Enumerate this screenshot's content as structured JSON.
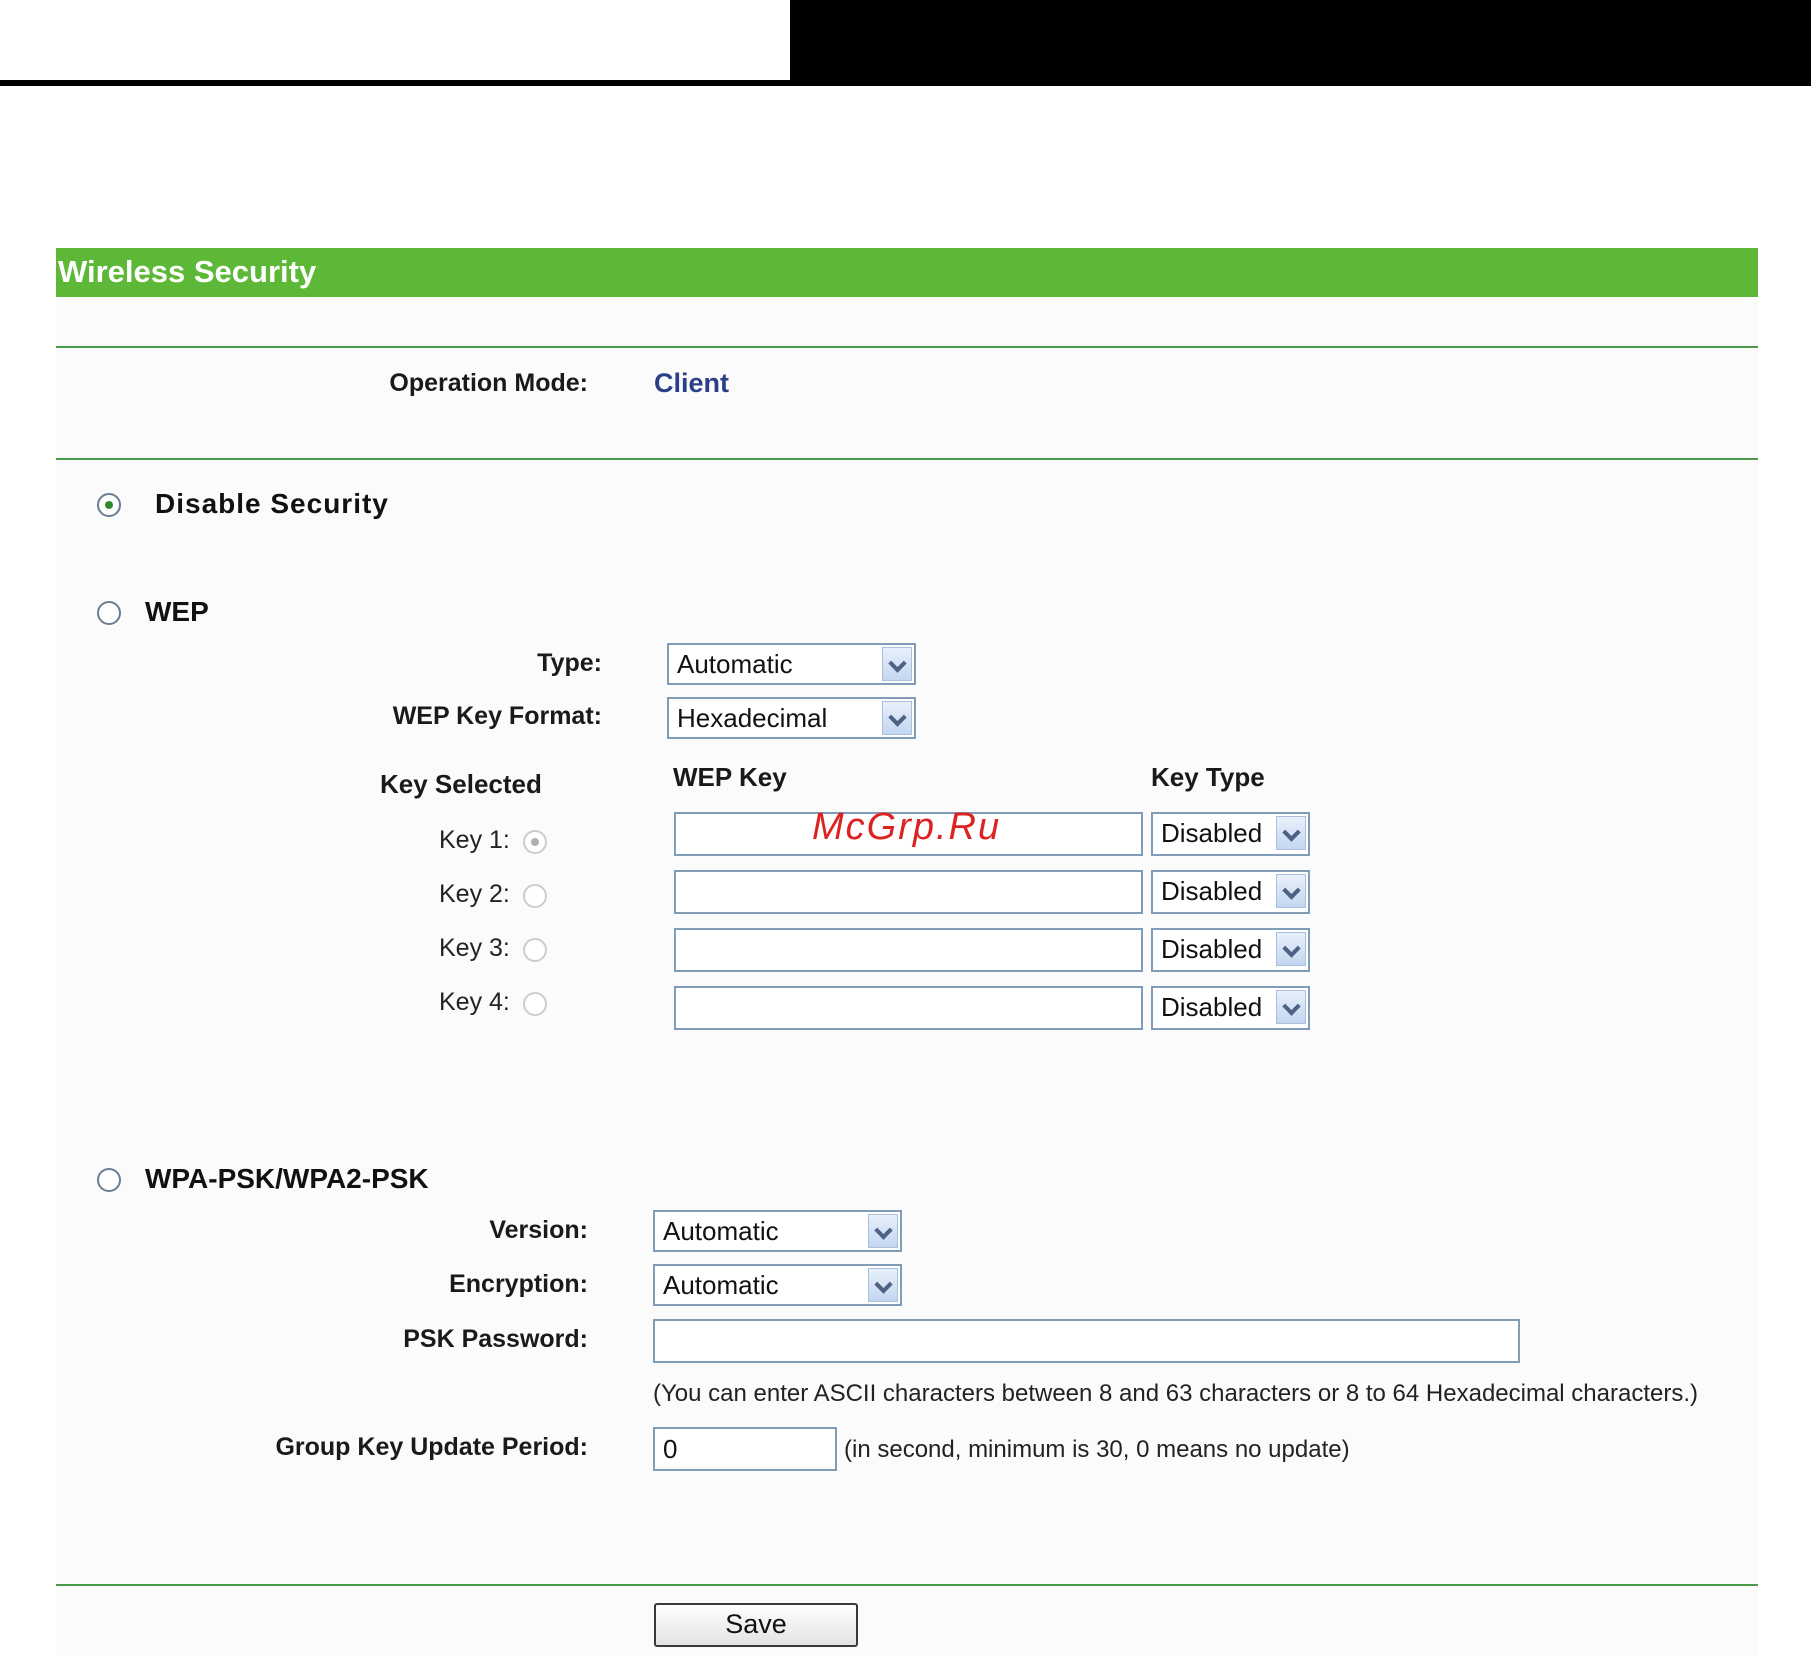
{
  "header": {
    "title": "Wireless Security"
  },
  "operation_mode": {
    "label": "Operation Mode:",
    "value": "Client"
  },
  "disable_security": {
    "label": "Disable Security",
    "selected": true
  },
  "wep": {
    "label": "WEP",
    "type_label": "Type:",
    "type_value": "Automatic",
    "format_label": "WEP Key Format:",
    "format_value": "Hexadecimal",
    "col_key_selected": "Key Selected",
    "col_wep_key": "WEP Key",
    "col_key_type": "Key Type",
    "keys": [
      {
        "label": "Key 1:",
        "value": "",
        "type": "Disabled"
      },
      {
        "label": "Key 2:",
        "value": "",
        "type": "Disabled"
      },
      {
        "label": "Key 3:",
        "value": "",
        "type": "Disabled"
      },
      {
        "label": "Key 4:",
        "value": "",
        "type": "Disabled"
      }
    ]
  },
  "wpa": {
    "label": "WPA-PSK/WPA2-PSK",
    "version_label": "Version:",
    "version_value": "Automatic",
    "encryption_label": "Encryption:",
    "encryption_value": "Automatic",
    "psk_label": "PSK Password:",
    "psk_value": "",
    "psk_note": "(You can enter ASCII characters between 8 and 63 characters or 8 to 64 Hexadecimal characters.)",
    "group_label": "Group Key Update Period:",
    "group_value": "0",
    "group_note": "(in second, minimum is 30, 0 means no update)"
  },
  "save_label": "Save",
  "watermark": "McGrp.Ru"
}
